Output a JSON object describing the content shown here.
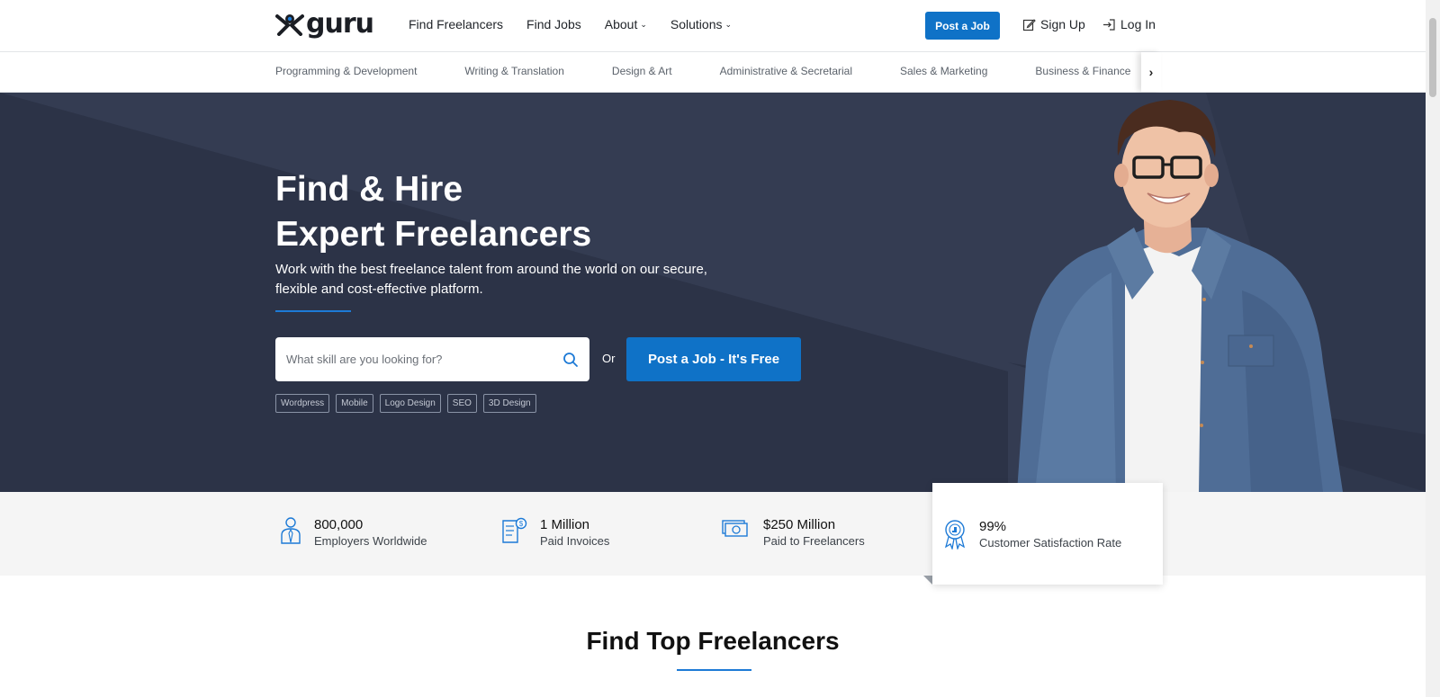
{
  "header": {
    "logo_text": "guru",
    "nav": [
      {
        "label": "Find Freelancers"
      },
      {
        "label": "Find Jobs"
      },
      {
        "label": "About"
      },
      {
        "label": "Solutions"
      }
    ],
    "post_job_label": "Post a Job",
    "signup_label": "Sign Up",
    "login_label": "Log In"
  },
  "categories": [
    "Programming & Development",
    "Writing & Translation",
    "Design & Art",
    "Administrative & Secretarial",
    "Sales & Marketing",
    "Business & Finance"
  ],
  "hero": {
    "title_line1": "Find & Hire",
    "title_line2": "Expert Freelancers",
    "subtitle": "Work with the best freelance talent from around the world on our secure, flexible and cost-effective platform.",
    "search_placeholder": "What skill are you looking for?",
    "or_text": "Or",
    "cta_label": "Post a Job - It's Free",
    "tags": [
      "Wordpress",
      "Mobile",
      "Logo Design",
      "SEO",
      "3D Design"
    ]
  },
  "stats": [
    {
      "number": "800,000",
      "label": "Employers Worldwide",
      "icon": "employer-icon"
    },
    {
      "number": "1 Million",
      "label": "Paid Invoices",
      "icon": "invoice-icon"
    },
    {
      "number": "$250 Million",
      "label": "Paid to Freelancers",
      "icon": "money-icon"
    },
    {
      "number": "99%",
      "label": "Customer Satisfaction Rate",
      "icon": "award-icon"
    }
  ],
  "section": {
    "title": "Find Top Freelancers"
  },
  "colors": {
    "brand_blue": "#0f72c7",
    "hero_bg": "#343c52",
    "hero_bg_dark": "#2c3347"
  }
}
